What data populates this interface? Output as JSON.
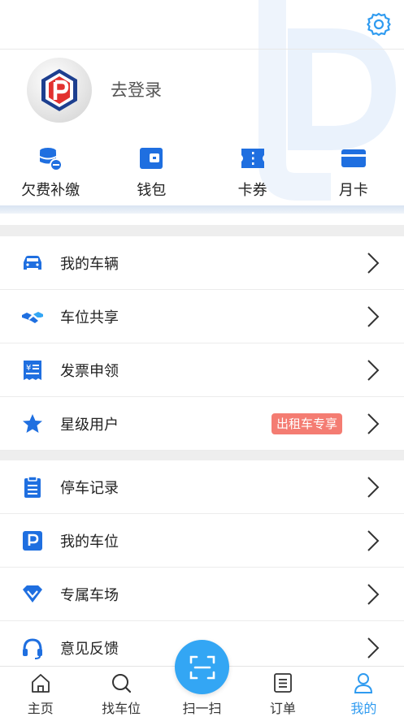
{
  "colors": {
    "primary": "#1f6fe0",
    "accent": "#33a6f4",
    "badge": "#f47c72",
    "active_tab": "#2f9bf0"
  },
  "header": {
    "settings_icon": "gear-icon"
  },
  "profile": {
    "login_label": "去登录",
    "avatar_icon": "parking-logo"
  },
  "quick_actions": [
    {
      "label": "欠费补缴",
      "icon": "coins-minus-icon"
    },
    {
      "label": "钱包",
      "icon": "wallet-icon"
    },
    {
      "label": "卡券",
      "icon": "ticket-icon"
    },
    {
      "label": "月卡",
      "icon": "card-icon"
    }
  ],
  "menu_group_1": [
    {
      "label": "我的车辆",
      "icon": "car-icon"
    },
    {
      "label": "车位共享",
      "icon": "handshake-icon"
    },
    {
      "label": "发票申领",
      "icon": "invoice-icon"
    },
    {
      "label": "星级用户",
      "icon": "star-icon",
      "badge": "出租车专享"
    }
  ],
  "menu_group_2": [
    {
      "label": "停车记录",
      "icon": "clipboard-icon"
    },
    {
      "label": "我的车位",
      "icon": "parking-icon"
    },
    {
      "label": "专属车场",
      "icon": "diamond-icon"
    },
    {
      "label": "意见反馈",
      "icon": "headset-icon"
    }
  ],
  "tabbar": {
    "items": [
      {
        "label": "主页",
        "icon": "home-icon"
      },
      {
        "label": "找车位",
        "icon": "search-icon"
      },
      {
        "label": "扫一扫",
        "icon": "scan-icon"
      },
      {
        "label": "订单",
        "icon": "order-icon"
      },
      {
        "label": "我的",
        "icon": "user-icon",
        "active": true
      }
    ]
  }
}
